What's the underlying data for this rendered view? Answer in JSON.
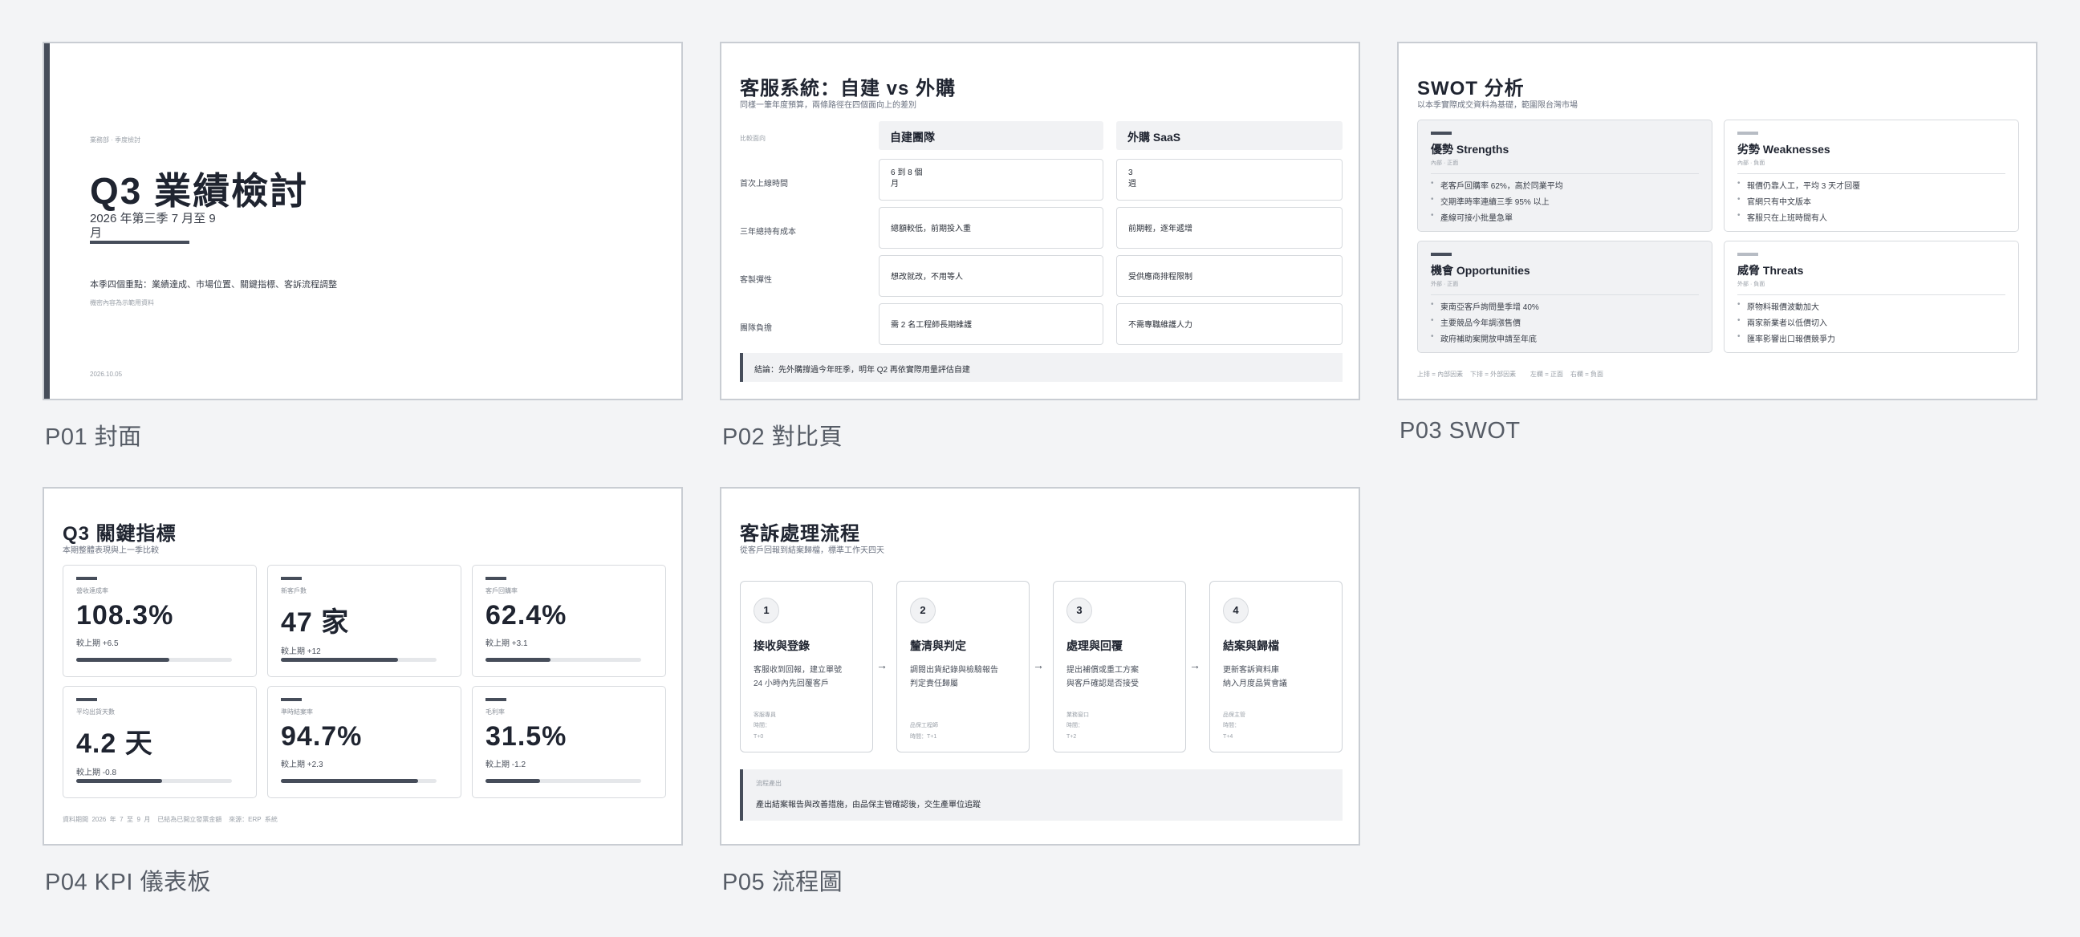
{
  "slides": [
    {
      "caption": "P01 封面",
      "eyebrow": "業務部 · 季度檢討",
      "title": "Q3  業績檢討",
      "subtitle_line1": "2026  年第三季    7  月至  9",
      "subtitle_line2": "月",
      "summary": "本季四個重點：業績達成、市場位置、關鍵指標、客訴流程調整",
      "note": "機密內容為示範用資料",
      "date": "2026.10.05"
    },
    {
      "caption": "P02 對比頁",
      "title": "客服系統：自建  vs  外購",
      "subtitle": "同樣一筆年度預算，兩條路徑在四個面向上的差別",
      "corner_label": "比較面向",
      "col_a": "自建團隊",
      "col_b": "外購  SaaS",
      "rows": [
        {
          "label": "首次上線時間",
          "a1": "6  到  8  個",
          "a2": "月",
          "b1": "3",
          "b2": "週"
        },
        {
          "label": "三年總持有成本",
          "a1": "總額較低，前期投入重",
          "a2": "",
          "b1": "前期輕，逐年遞增",
          "b2": ""
        },
        {
          "label": "客製彈性",
          "a1": "想改就改，不用等人",
          "a2": "",
          "b1": "受供應商排程限制",
          "b2": ""
        },
        {
          "label": "團隊負擔",
          "a1": "需  2  名工程師長期維護",
          "a2": "",
          "b1": "不需專職維護人力",
          "b2": ""
        }
      ],
      "conclusion": "結論：先外購撐過今年旺季，明年  Q2  再依實際用量評估自建"
    },
    {
      "caption": "P03 SWOT",
      "title": "SWOT  分析",
      "subtitle": "以本季實際成交資料為基礎，範圍限台灣市場",
      "quadrants": [
        {
          "title": "優勢  Strengths",
          "tag": "內部 · 正面",
          "items": [
            "老客戶回購率  62%，高於同業平均",
            "交期準時率連續三季  95%  以上",
            "產線可接小批量急單"
          ]
        },
        {
          "title": "劣勢  Weaknesses",
          "tag": "內部 · 負面",
          "items": [
            "報價仍靠人工，平均  3  天才回覆",
            "官網只有中文版本",
            "客服只在上班時間有人"
          ]
        },
        {
          "title": "機會  Opportunities",
          "tag": "外部 · 正面",
          "items": [
            "東南亞客戶詢問量季增  40%",
            "主要競品今年調漲售價",
            "政府補助案開放申請至年底"
          ]
        },
        {
          "title": "威脅  Threats",
          "tag": "外部 · 負面",
          "items": [
            "原物料報價波動加大",
            "兩家新業者以低價切入",
            "匯率影響出口報價競爭力"
          ]
        }
      ],
      "footer": "上排 = 內部因素    下排 = 外部因素        左欄 = 正面    右欄 = 負面"
    },
    {
      "caption": "P04 KPI 儀表板",
      "title": "Q3  關鍵指標",
      "subtitle": "本期整體表現與上一季比較",
      "kpis": [
        {
          "label": "營收達成率",
          "value": "108.3%",
          "delta": "較上期  +6.5",
          "fill": 0.6
        },
        {
          "label": "新客戶數",
          "value": "47  家",
          "delta": "較上期  +12",
          "fill": 0.75
        },
        {
          "label": "客戶回購率",
          "value": "62.4%",
          "delta": "較上期  +3.1",
          "fill": 0.42
        },
        {
          "label": "平均出貨天數",
          "value": "4.2  天",
          "delta": "較上期  -0.8",
          "fill": 0.55
        },
        {
          "label": "準時結案率",
          "value": "94.7%",
          "delta": "較上期  +2.3",
          "fill": 0.88
        },
        {
          "label": "毛利率",
          "value": "31.5%",
          "delta": "較上期  -1.2",
          "fill": 0.35
        }
      ],
      "footer": "資料期間  2026  年  7  至  9  月    已結為已開立發票金額    來源：ERP  系統"
    },
    {
      "caption": "P05 流程圖",
      "title": "客訴處理流程",
      "subtitle": "從客戶回報到結案歸檔，標準工作天四天",
      "steps": [
        {
          "num": "1",
          "title": "接收與登錄",
          "desc1": "客服收到回報，建立單號",
          "desc2": "24  小時內先回覆客戶",
          "owner": "客服專員",
          "time_label": "時間：",
          "time": "T+0"
        },
        {
          "num": "2",
          "title": "釐清與判定",
          "desc1": "調閱出貨紀錄與檢驗報告",
          "desc2": "判定責任歸屬",
          "owner": "品保工程師",
          "time_label": "時間：T+1",
          "time": ""
        },
        {
          "num": "3",
          "title": "處理與回覆",
          "desc1": "提出補償或重工方案",
          "desc2": "與客戶確認是否接受",
          "owner": "業務窗口",
          "time_label": "時間：",
          "time": "T+2"
        },
        {
          "num": "4",
          "title": "結案與歸檔",
          "desc1": "更新客訴資料庫",
          "desc2": "納入月度品質會議",
          "owner": "品保主管",
          "time_label": "時間：",
          "time": "T+4"
        }
      ],
      "note_label": "流程產出",
      "note_text": "產出結案報告與改善措施，由品保主管確認後，交生產單位追蹤"
    }
  ]
}
